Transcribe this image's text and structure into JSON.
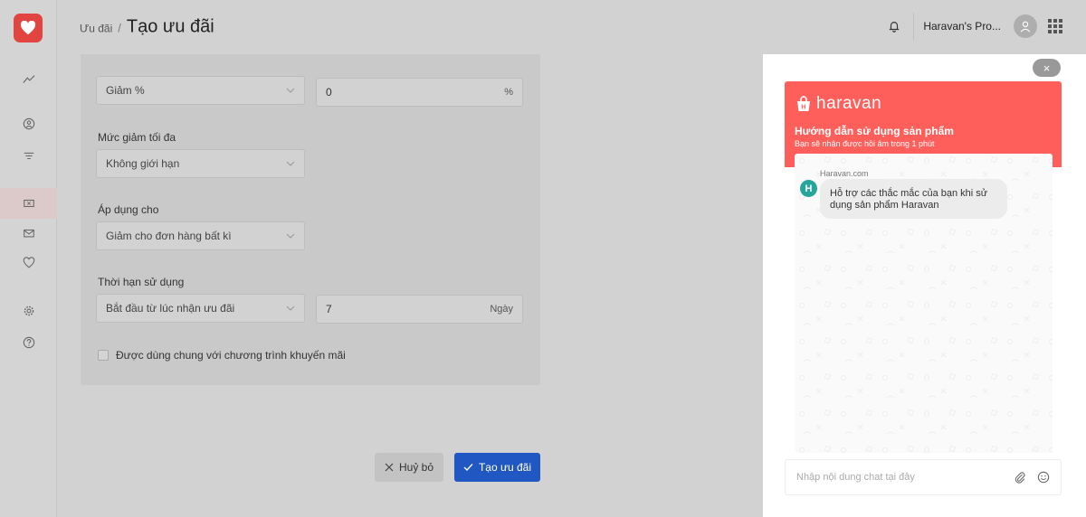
{
  "header": {
    "breadcrumb_parent": "Ưu đãi",
    "breadcrumb_sep": "/",
    "title": "Tạo ưu đãi",
    "store_name": "Haravan's Pro..."
  },
  "form": {
    "discount_type": {
      "value": "Giảm %"
    },
    "discount_value": {
      "value": "0",
      "suffix": "%"
    },
    "max_discount": {
      "label": "Mức giảm tối đa",
      "value": "Không giới hạn"
    },
    "apply_to": {
      "label": "Áp dụng cho",
      "value": "Giảm cho đơn hàng bất kì"
    },
    "validity": {
      "label": "Thời hạn sử dụng",
      "value": "Bắt đầu từ lúc nhận ưu đãi",
      "days": "7",
      "days_suffix": "Ngày"
    },
    "combine_label": "Được dùng chung với chương trình khuyến mãi"
  },
  "actions": {
    "cancel": "Huỷ bỏ",
    "create": "Tạo ưu đãi"
  },
  "chat": {
    "brand": "haravan",
    "title": "Hướng dẫn sử dụng sản phẩm",
    "subtitle": "Bạn sẽ nhận được hồi âm trong 1 phút",
    "message": {
      "sender": "Haravan.com",
      "avatar": "H",
      "text": "Hỗ trợ các thắc mắc của bạn khi sử dụng sản phẩm Haravan"
    },
    "input_placeholder": "Nhập nội dung chat tại đây",
    "close": "×"
  },
  "colors": {
    "brand_red": "#e2453f",
    "chat_header": "#ff5f5a",
    "primary_blue": "#2157c2",
    "avatar_teal": "#26a69a"
  }
}
